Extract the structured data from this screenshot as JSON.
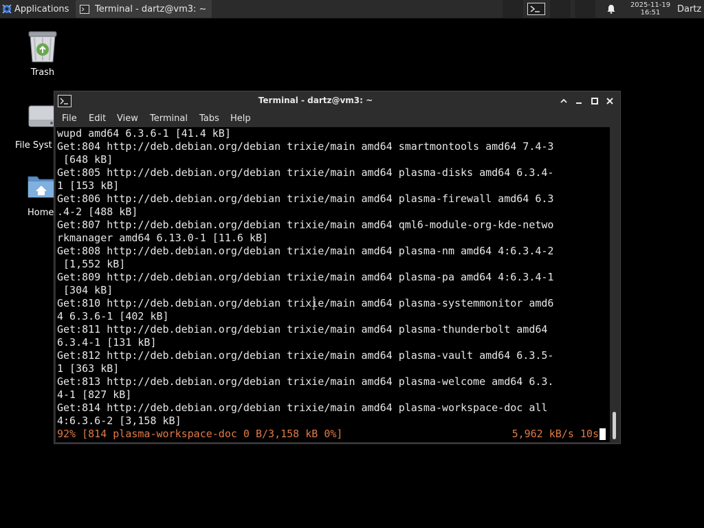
{
  "panel": {
    "applications_label": "Applications",
    "task_title": "Terminal - dartz@vm3: ~",
    "clock_date": "2025-11-19",
    "clock_time": "16:51",
    "user": "Dartz"
  },
  "desktop": {
    "icons": [
      {
        "label": "Trash",
        "icon": "trash-icon"
      },
      {
        "label": "File Syst",
        "icon": "drive-icon"
      },
      {
        "label": "Home",
        "icon": "home-folder-icon"
      }
    ]
  },
  "window": {
    "title": "Terminal - dartz@vm3: ~",
    "menu": [
      "File",
      "Edit",
      "View",
      "Terminal",
      "Tabs",
      "Help"
    ],
    "lines": [
      "wupd amd64 6.3.6-1 [41.4 kB]",
      "Get:804 http://deb.debian.org/debian trixie/main amd64 smartmontools amd64 7.4-3",
      " [648 kB]",
      "Get:805 http://deb.debian.org/debian trixie/main amd64 plasma-disks amd64 6.3.4-",
      "1 [153 kB]",
      "Get:806 http://deb.debian.org/debian trixie/main amd64 plasma-firewall amd64 6.3",
      ".4-2 [488 kB]",
      "Get:807 http://deb.debian.org/debian trixie/main amd64 qml6-module-org-kde-netwo",
      "rkmanager amd64 6.13.0-1 [11.6 kB]",
      "Get:808 http://deb.debian.org/debian trixie/main amd64 plasma-nm amd64 4:6.3.4-2",
      " [1,552 kB]",
      "Get:809 http://deb.debian.org/debian trixie/main amd64 plasma-pa amd64 4:6.3.4-1",
      " [304 kB]",
      "Get:810 http://deb.debian.org/debian trixie/main amd64 plasma-systemmonitor amd6",
      "4 6.3.6-1 [402 kB]",
      "Get:811 http://deb.debian.org/debian trixie/main amd64 plasma-thunderbolt amd64",
      "6.3.4-1 [131 kB]",
      "Get:812 http://deb.debian.org/debian trixie/main amd64 plasma-vault amd64 6.3.5-",
      "1 [363 kB]",
      "Get:813 http://deb.debian.org/debian trixie/main amd64 plasma-welcome amd64 6.3.",
      "4-1 [827 kB]",
      "Get:814 http://deb.debian.org/debian trixie/main amd64 plasma-workspace-doc all",
      "4:6.3.6-2 [3,158 kB]"
    ],
    "status_left": "92% [814 plasma-workspace-doc 0 B/3,158 kB 0%]",
    "status_right": "5,962 kB/s 10s",
    "colors": {
      "progress_text": "#e07a45",
      "terminal_bg": "#000000",
      "terminal_fg": "#e8e8e8"
    }
  }
}
